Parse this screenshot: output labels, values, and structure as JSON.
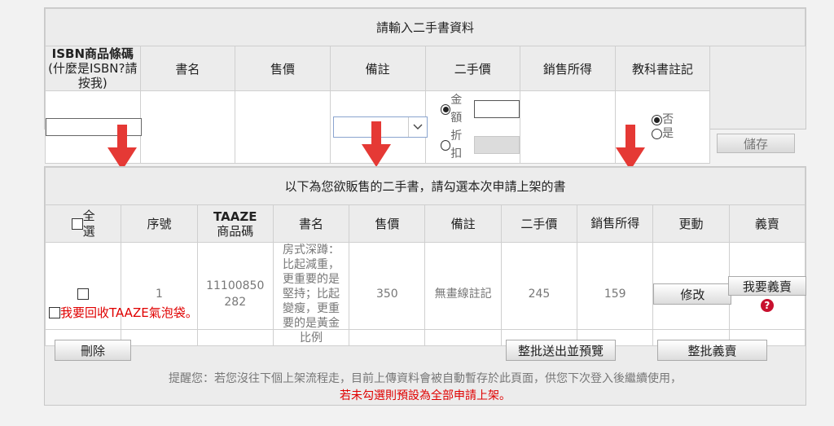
{
  "top": {
    "title": "請輸入二手書資料",
    "headers": {
      "isbn_line1": "ISBN商品條碼",
      "isbn_line2_prefix": "(",
      "isbn_link": "什麼是ISBN?請按我",
      "isbn_line2_suffix": ")",
      "book_name": "書名",
      "price": "售價",
      "remark": "備註",
      "used_price": "二手價",
      "sales_income": "銷售所得",
      "textbook_note": "教科書註記"
    },
    "remark_select_value": "",
    "used_price_options": {
      "amount": "金額",
      "discount": "折扣",
      "selected": "金額"
    },
    "textbook_options": {
      "no": "否",
      "yes": "是",
      "selected": "否"
    },
    "save_button": "儲存"
  },
  "bottom": {
    "title": "以下為您欲販售的二手書，請勾選本次申請上架的書",
    "headers": {
      "select_all": "全選",
      "seq": "序號",
      "taaze_code_line1": "TAAZE",
      "taaze_code_line2": "商品碼",
      "book_name": "書名",
      "price": "售價",
      "remark": "備註",
      "used_price": "二手價",
      "sales_income": "銷售所得",
      "update": "更動",
      "charity": "義賣"
    },
    "rows": [
      {
        "seq": "1",
        "taaze_code": "11100850282",
        "book_name": "房式深蹲：比起減重，更重要的是堅持；比起變瘦，更重要的是黃金比例",
        "price": "350",
        "remark": "無畫線註記",
        "used_price": "245",
        "sales_income": "159",
        "modify_button": "修改",
        "charity_button": "我要義賣"
      }
    ],
    "recycle_label": "我要回收TAAZE氣泡袋。",
    "delete_button": "刪除",
    "batch_preview_button": "整批送出並預覽",
    "batch_charity_button": "整批義賣",
    "notice_line1": "提醒您：若您沒往下個上架流程走，目前上傳資料會被自動暫存於此頁面，供您下次登入後繼續使用，",
    "notice_line2": "若未勾選則預設為全部申請上架。"
  },
  "colors": {
    "arrow": "#e53935",
    "notice_red": "#e00000",
    "link": "#333333"
  }
}
